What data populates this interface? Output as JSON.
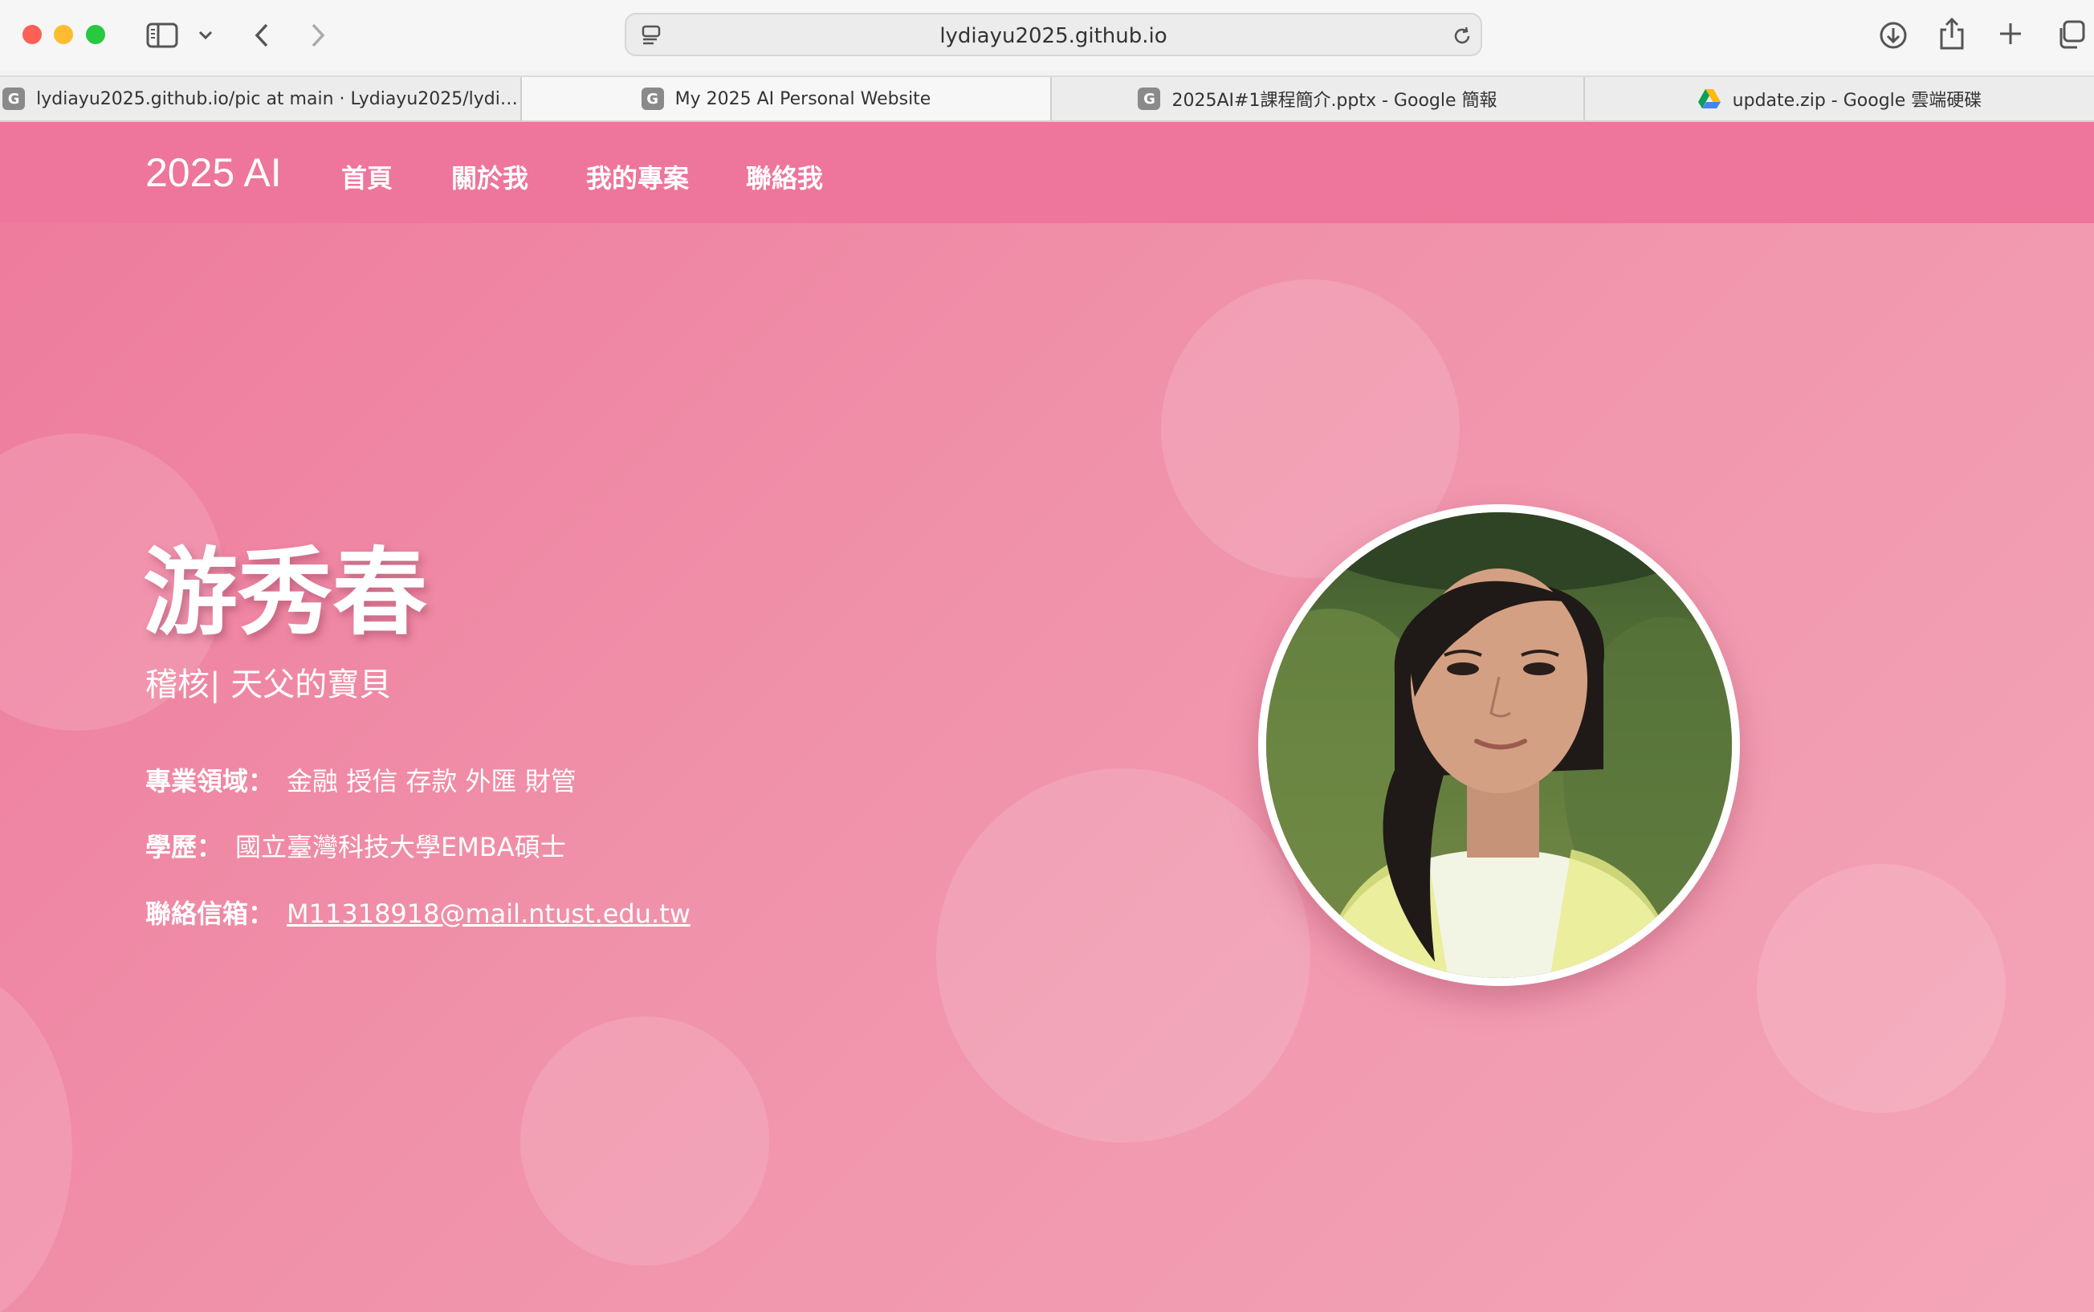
{
  "browser": {
    "url": "lydiayu2025.github.io",
    "tabs": [
      {
        "favicon_letter": "G",
        "title": "lydiayu2025.github.io/pic at main · Lydiayu2025/lydi…",
        "active": false
      },
      {
        "favicon_letter": "G",
        "title": "My 2025 AI Personal Website",
        "active": true
      },
      {
        "favicon_letter": "G",
        "title": "2025AI#1課程簡介.pptx - Google 簡報",
        "active": false
      },
      {
        "favicon_letter": "",
        "title": "update.zip - Google 雲端硬碟",
        "active": false
      }
    ],
    "icons": [
      "sidebar-icon",
      "chevron-down-icon",
      "back-icon",
      "forward-icon",
      "reader-icon",
      "reload-icon",
      "download-icon",
      "share-icon",
      "new-tab-icon",
      "tab-overview-icon",
      "google-drive-icon"
    ],
    "colors": {
      "close": "#fe5f57",
      "minimize": "#febc2e",
      "zoom": "#28c840"
    }
  },
  "nav": {
    "brand": "2025 AI",
    "links": [
      "首頁",
      "關於我",
      "我的專案",
      "聯絡我"
    ]
  },
  "hero": {
    "name": "游秀春",
    "subtitle": "稽核| 天父的寶貝",
    "expertise_label": "專業領域：",
    "expertise_value": "金融 授信 存款 外匯 財管",
    "education_label": "學歷：",
    "education_value": "國立臺灣科技大學EMBA碩士",
    "email_label": "聯絡信箱：",
    "email_value": "M11318918@mail.ntust.edu.tw"
  },
  "theme": {
    "nav_bg": "#ee759c",
    "page_bg": "#f092aa",
    "text": "#ffffff"
  }
}
